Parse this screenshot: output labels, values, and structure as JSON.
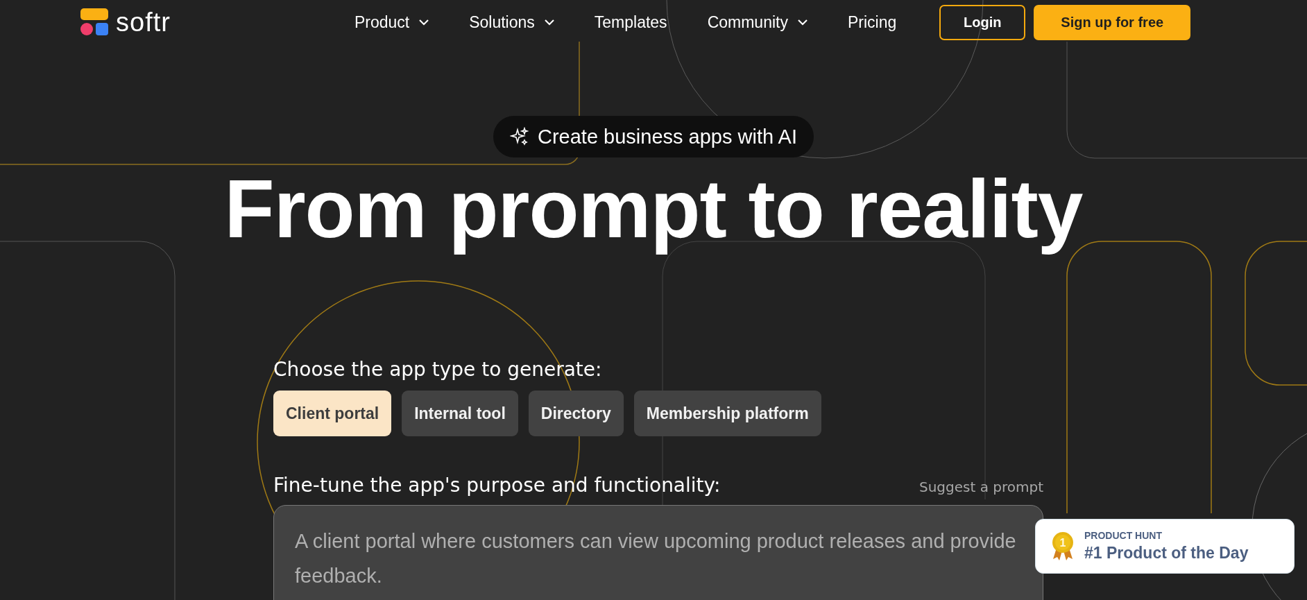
{
  "header": {
    "logo": "softr",
    "nav": [
      {
        "label": "Product",
        "dropdown": true
      },
      {
        "label": "Solutions",
        "dropdown": true
      },
      {
        "label": "Templates",
        "dropdown": false
      },
      {
        "label": "Community",
        "dropdown": true
      },
      {
        "label": "Pricing",
        "dropdown": false
      }
    ],
    "login": "Login",
    "signup": "Sign up for free"
  },
  "hero": {
    "badge": "Create business apps with AI",
    "title": "From prompt to reality"
  },
  "generator": {
    "type_label": "Choose the app type to generate:",
    "types": [
      {
        "label": "Client portal",
        "selected": true
      },
      {
        "label": "Internal tool",
        "selected": false
      },
      {
        "label": "Directory",
        "selected": false
      },
      {
        "label": "Membership platform",
        "selected": false
      }
    ],
    "purpose_label": "Fine-tune the app's purpose and functionality:",
    "suggest": "Suggest a prompt",
    "prompt": "A client portal where customers can view upcoming product releases and provide feedback."
  },
  "award": {
    "source": "PRODUCT HUNT",
    "title": "#1 Product of the Day",
    "rank": "1"
  }
}
